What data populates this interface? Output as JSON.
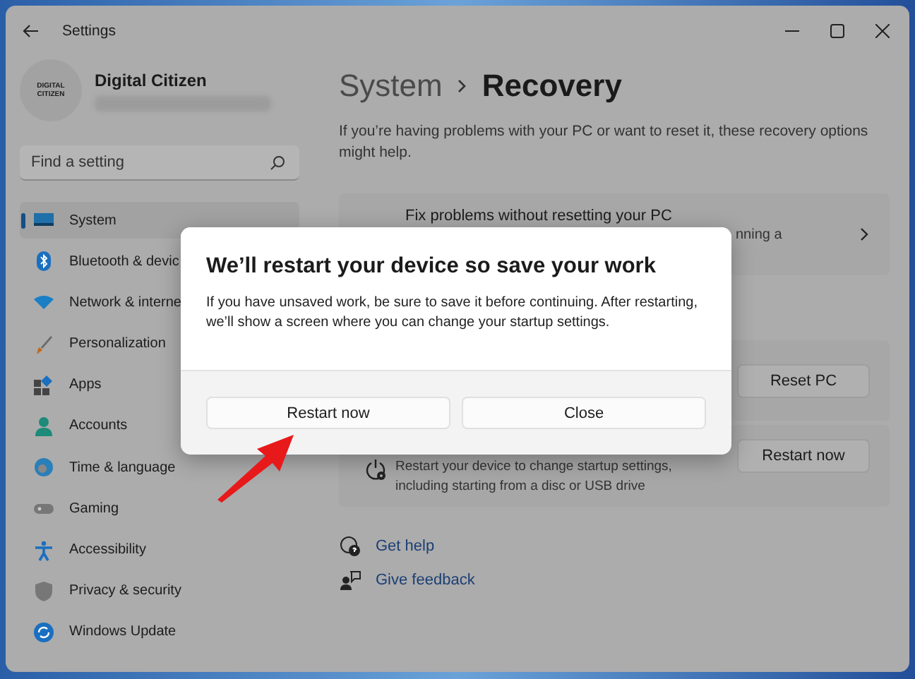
{
  "window": {
    "title": "Settings"
  },
  "profile": {
    "name": "Digital Citizen",
    "avatar_lines": [
      "DIGITAL",
      "CITIZEN"
    ]
  },
  "search": {
    "placeholder": "Find a setting"
  },
  "sidebar": {
    "items": [
      {
        "label": "System",
        "kind": "system",
        "selected": true
      },
      {
        "label": "Bluetooth & devic",
        "kind": "bluetooth",
        "selected": false
      },
      {
        "label": "Network & interne",
        "kind": "network",
        "selected": false
      },
      {
        "label": "Personalization",
        "kind": "brush",
        "selected": false
      },
      {
        "label": "Apps",
        "kind": "apps",
        "selected": false
      },
      {
        "label": "Accounts",
        "kind": "person",
        "selected": false
      },
      {
        "label": "Time & language",
        "kind": "globe",
        "selected": false
      },
      {
        "label": "Gaming",
        "kind": "gamepad",
        "selected": false
      },
      {
        "label": "Accessibility",
        "kind": "accessibility",
        "selected": false
      },
      {
        "label": "Privacy & security",
        "kind": "shield",
        "selected": false
      },
      {
        "label": "Windows Update",
        "kind": "update",
        "selected": false
      }
    ]
  },
  "breadcrumb": {
    "parent": "System",
    "current": "Recovery"
  },
  "description": "If you’re having problems with your PC or want to reset it, these recovery options might help.",
  "cards": [
    {
      "kind": "link",
      "title": "Fix problems without resetting your PC",
      "description": "nning a"
    },
    {
      "kind": "action",
      "button": "Reset PC"
    },
    {
      "kind": "action",
      "description": "Restart your device to change startup settings, including starting from a disc or USB drive",
      "button": "Restart now"
    }
  ],
  "links": [
    {
      "kind": "help",
      "label": "Get help"
    },
    {
      "kind": "feedback",
      "label": "Give feedback"
    }
  ],
  "dialog": {
    "title": "We’ll restart your device so save your work",
    "body": "If you have unsaved work, be sure to save it before continuing. After restarting, we’ll show a screen where you can change your startup settings.",
    "buttons": [
      "Restart now",
      "Close"
    ]
  }
}
